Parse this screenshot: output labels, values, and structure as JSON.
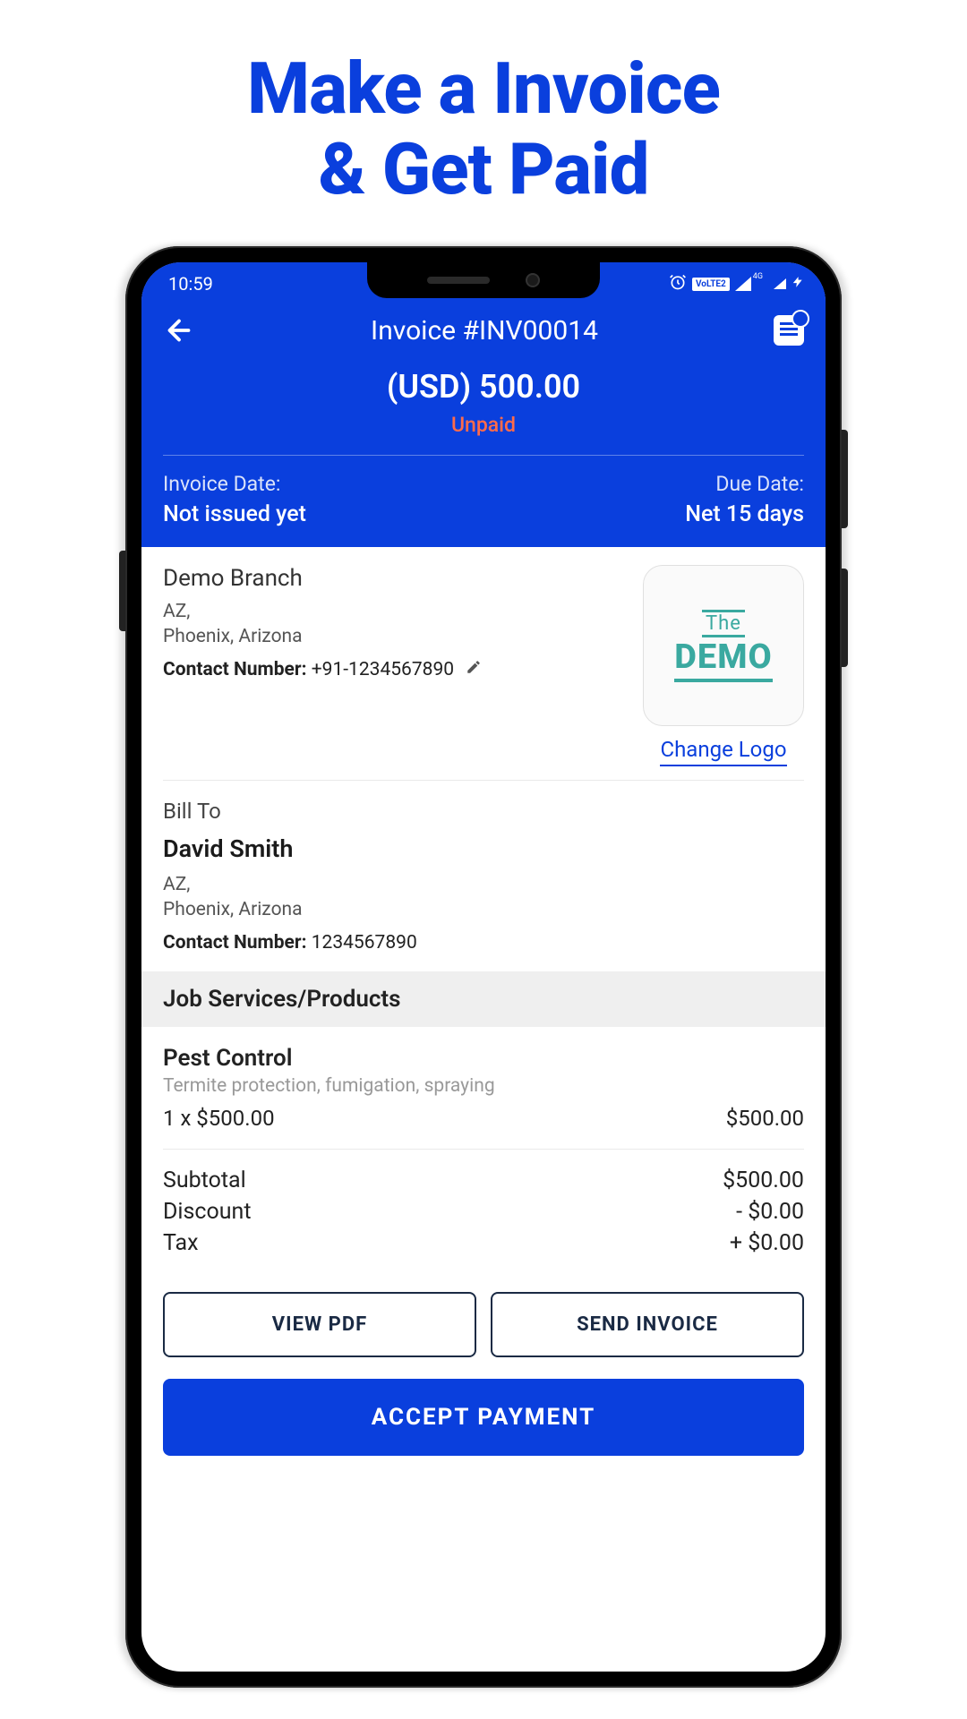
{
  "page": {
    "title_line1": "Make a Invoice",
    "title_line2": "& Get Paid"
  },
  "status_bar": {
    "time": "10:59",
    "volte": "VoLTE2",
    "net": "4G"
  },
  "header": {
    "title": "Invoice #INV00014",
    "amount": "(USD) 500.00",
    "status": "Unpaid",
    "invoice_date_label": "Invoice Date:",
    "invoice_date_value": "Not issued yet",
    "due_date_label": "Due Date:",
    "due_date_value": "Net 15 days"
  },
  "from": {
    "name": "Demo Branch",
    "line1": "AZ,",
    "line2": "Phoenix, Arizona",
    "contact_label": "Contact Number:",
    "contact_value": " +91-1234567890",
    "change_logo": "Change Logo",
    "logo_top": "The",
    "logo_main": "DEMO"
  },
  "billto": {
    "label": "Bill To",
    "name": "David Smith",
    "line1": "AZ,",
    "line2": "Phoenix, Arizona",
    "contact_label": "Contact Number:",
    "contact_value": " 1234567890"
  },
  "services": {
    "header": "Job Services/Products",
    "item_name": "Pest Control",
    "item_desc": "Termite protection, fumigation, spraying",
    "item_qty_price": "1 x $500.00",
    "item_total": "$500.00"
  },
  "totals": {
    "subtotal_label": "Subtotal",
    "subtotal_value": "$500.00",
    "discount_label": "Discount",
    "discount_value": "- $0.00",
    "tax_label": "Tax",
    "tax_value": "+ $0.00"
  },
  "buttons": {
    "view_pdf": "VIEW PDF",
    "send_invoice": "SEND INVOICE",
    "accept_payment": "ACCEPT PAYMENT"
  }
}
